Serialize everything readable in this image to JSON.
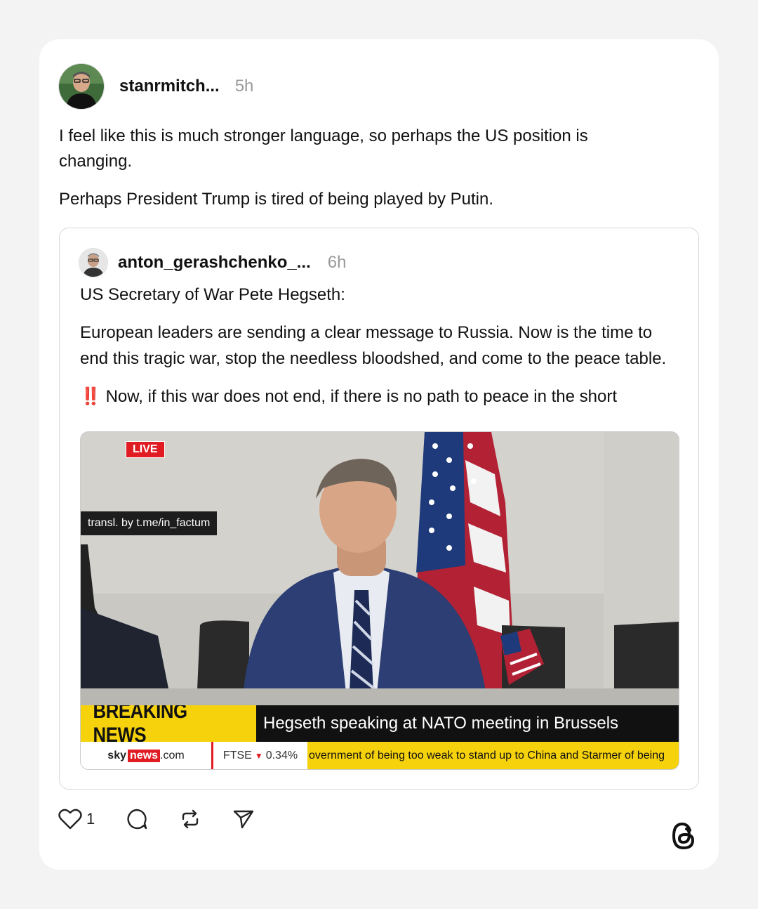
{
  "post": {
    "author": "stanrmitch...",
    "time": "5h",
    "paragraphs": [
      "I feel like this is much stronger language, so perhaps the US position is changing.",
      "Perhaps President Trump is tired of being played by Putin."
    ]
  },
  "quote": {
    "author": "anton_gerashchenko_...",
    "time": "6h",
    "title_line": "US Secretary of War Pete Hegseth:",
    "body": "European leaders are sending a clear message to Russia. Now is the time to end this tragic war, stop the needless bloodshed, and come to the peace table.",
    "emoji": "‼️",
    "truncated_line": "Now, if this war does not end, if there is no path to peace in the short"
  },
  "video": {
    "live_badge": "LIVE",
    "translation_tag": "transl. by t.me/in_factum",
    "breaking_label": "BREAKING NEWS",
    "headline": "Hegseth speaking at NATO meeting in Brussels",
    "brand_sky": "sky",
    "brand_news": "news",
    "brand_com": ".com",
    "ftse_label": "FTSE",
    "ftse_arrow": "▼",
    "ftse_value": "0.34%",
    "ticker_text": "overnment of being too weak to stand up to China and Starmer of being"
  },
  "actions": {
    "like_count": "1",
    "like_icon": "heart-icon",
    "reply_icon": "comment-icon",
    "repost_icon": "repost-icon",
    "share_icon": "send-icon"
  },
  "app": {
    "logo": "threads-logo-icon"
  }
}
